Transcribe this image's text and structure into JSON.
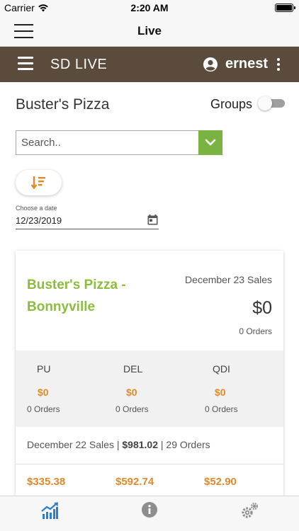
{
  "status_bar": {
    "carrier": "Carrier",
    "time": "2:20 AM"
  },
  "nav_bar": {
    "title": "Live"
  },
  "app_bar": {
    "brand": "SD LIVE",
    "username": "ernest",
    "bg_color": "#5a4b3c"
  },
  "page": {
    "store_title": "Buster's Pizza",
    "groups_label": "Groups",
    "groups_enabled": false
  },
  "search": {
    "placeholder": "Search..",
    "value": ""
  },
  "date": {
    "label": "Choose a date",
    "value": "12/23/2019"
  },
  "card": {
    "store_name": "Buster's Pizza - Bonnyville",
    "sales_label": "December 23 Sales",
    "sales_value": "$0",
    "orders": "0 Orders",
    "breakdown": [
      {
        "code": "PU",
        "amount": "$0",
        "orders": "0 Orders"
      },
      {
        "code": "DEL",
        "amount": "$0",
        "orders": "0 Orders"
      },
      {
        "code": "QDI",
        "amount": "$0",
        "orders": "0 Orders"
      }
    ],
    "previous": {
      "label": "December 22 Sales |",
      "total": "$981.02",
      "orders": "| 29 Orders",
      "amounts": [
        "$335.38",
        "$592.74",
        "$52.90"
      ]
    }
  },
  "colors": {
    "accent_green": "#8bbd3e",
    "amount_orange": "#e08a2e",
    "search_button": "#7bb342"
  },
  "tabs": [
    {
      "icon": "chart-up-icon",
      "active": true
    },
    {
      "icon": "info-icon",
      "active": false
    },
    {
      "icon": "gears-icon",
      "active": false
    }
  ]
}
